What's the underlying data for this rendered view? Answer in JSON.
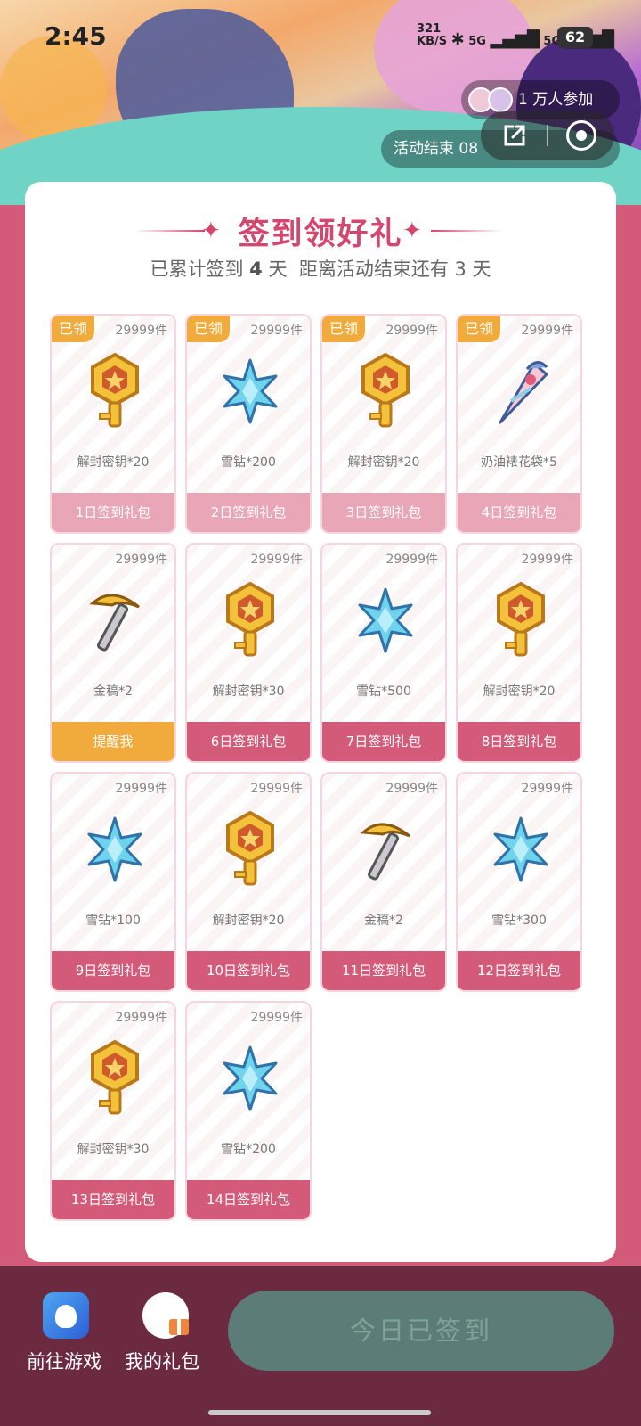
{
  "status": {
    "time": "2:45",
    "net_speed": "321\nKB/S",
    "signal": "5G",
    "signal2": "5G",
    "battery": "62"
  },
  "banner": {
    "participants": "1 万人参加",
    "end_label": "活动结束 08"
  },
  "panel": {
    "title": "签到领好礼",
    "subtitle_a": "已累计签到",
    "days_count": "4",
    "subtitle_b": "天  距离活动结束还有 3 天"
  },
  "cards": [
    {
      "count": "29999件",
      "item": "解封密钥*20",
      "button": "1日签到礼包",
      "state": "claimed",
      "tag": "已领",
      "icon": "key-icon"
    },
    {
      "count": "29999件",
      "item": "雪钻*200",
      "button": "2日签到礼包",
      "state": "claimed",
      "tag": "已领",
      "icon": "snow-diamond-icon"
    },
    {
      "count": "29999件",
      "item": "解封密钥*20",
      "button": "3日签到礼包",
      "state": "claimed",
      "tag": "已领",
      "icon": "key-icon"
    },
    {
      "count": "29999件",
      "item": "奶油裱花袋*5",
      "button": "4日签到礼包",
      "state": "claimed",
      "tag": "已领",
      "icon": "piping-bag-icon"
    },
    {
      "count": "29999件",
      "item": "金稿*2",
      "button": "提醒我",
      "state": "remind",
      "tag": "",
      "icon": "pickaxe-icon"
    },
    {
      "count": "29999件",
      "item": "解封密钥*30",
      "button": "6日签到礼包",
      "state": "normal",
      "tag": "",
      "icon": "key-icon"
    },
    {
      "count": "29999件",
      "item": "雪钻*500",
      "button": "7日签到礼包",
      "state": "normal",
      "tag": "",
      "icon": "snow-diamond-icon"
    },
    {
      "count": "29999件",
      "item": "解封密钥*20",
      "button": "8日签到礼包",
      "state": "normal",
      "tag": "",
      "icon": "key-icon"
    },
    {
      "count": "29999件",
      "item": "雪钻*100",
      "button": "9日签到礼包",
      "state": "normal",
      "tag": "",
      "icon": "snow-diamond-icon"
    },
    {
      "count": "29999件",
      "item": "解封密钥*20",
      "button": "10日签到礼包",
      "state": "normal",
      "tag": "",
      "icon": "key-icon"
    },
    {
      "count": "29999件",
      "item": "金稿*2",
      "button": "11日签到礼包",
      "state": "normal",
      "tag": "",
      "icon": "pickaxe-icon"
    },
    {
      "count": "29999件",
      "item": "雪钻*300",
      "button": "12日签到礼包",
      "state": "normal",
      "tag": "",
      "icon": "snow-diamond-icon"
    },
    {
      "count": "29999件",
      "item": "解封密钥*30",
      "button": "13日签到礼包",
      "state": "normal",
      "tag": "",
      "icon": "key-icon"
    },
    {
      "count": "29999件",
      "item": "雪钻*200",
      "button": "14日签到礼包",
      "state": "normal",
      "tag": "",
      "icon": "snow-diamond-icon"
    }
  ],
  "bottom": {
    "goto_game": "前往游戏",
    "my_gifts": "我的礼包",
    "signed_button": "今日已签到"
  },
  "colors": {
    "accent": "#d35a78",
    "claimed": "#e8a6b6",
    "remind": "#f0ab3c",
    "bottom_bg": "#6b2a3f",
    "signed_btn": "#5c7d77"
  }
}
